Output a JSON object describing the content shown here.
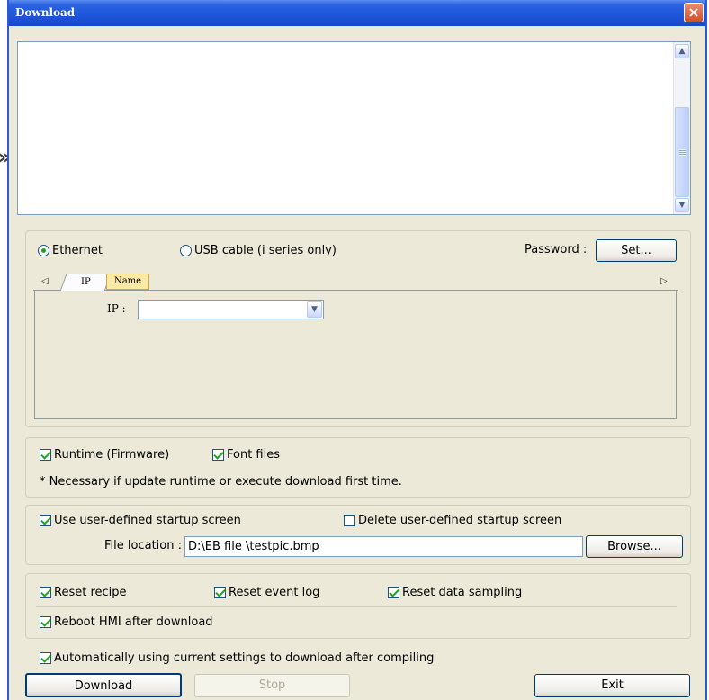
{
  "window": {
    "title": "Download",
    "close_glyph": "×"
  },
  "log": {
    "lines": []
  },
  "connection": {
    "ethernet_label": "Ethernet",
    "ethernet_selected": true,
    "usb_label": "USB cable (i series only)",
    "usb_selected": false,
    "password_label": "Password :",
    "set_button": "Set..."
  },
  "tabs": {
    "left_arrow": "◁",
    "right_arrow": "▷",
    "items": [
      {
        "label": "IP",
        "active": true
      },
      {
        "label": "Name",
        "active": false
      }
    ]
  },
  "ip_field": {
    "label": "IP :",
    "value": ""
  },
  "firmware": {
    "runtime_label": "Runtime (Firmware)",
    "runtime_checked": true,
    "font_label": "Font files",
    "font_checked": true,
    "note": "* Necessary if update runtime  or execute download first time."
  },
  "startup": {
    "use_label": "Use user-defined startup screen",
    "use_checked": true,
    "delete_label": "Delete user-defined startup screen",
    "delete_checked": false,
    "file_label": "File location :",
    "file_value": "D:\\EB file \\testpic.bmp",
    "browse_button": "Browse..."
  },
  "reset": {
    "recipe_label": "Reset recipe",
    "recipe_checked": true,
    "event_label": "Reset event log",
    "event_checked": true,
    "sampling_label": "Reset data sampling",
    "sampling_checked": true,
    "reboot_label": "Reboot HMI after download",
    "reboot_checked": true
  },
  "auto": {
    "label": "Automatically using current settings to download after compiling",
    "checked": true
  },
  "buttons": {
    "download": "Download",
    "stop": "Stop",
    "exit": "Exit"
  },
  "colors": {
    "titlebar": "#2c63e0",
    "dialog_bg": "#ece9d8",
    "check": "#21a121",
    "close": "#d24e29"
  }
}
